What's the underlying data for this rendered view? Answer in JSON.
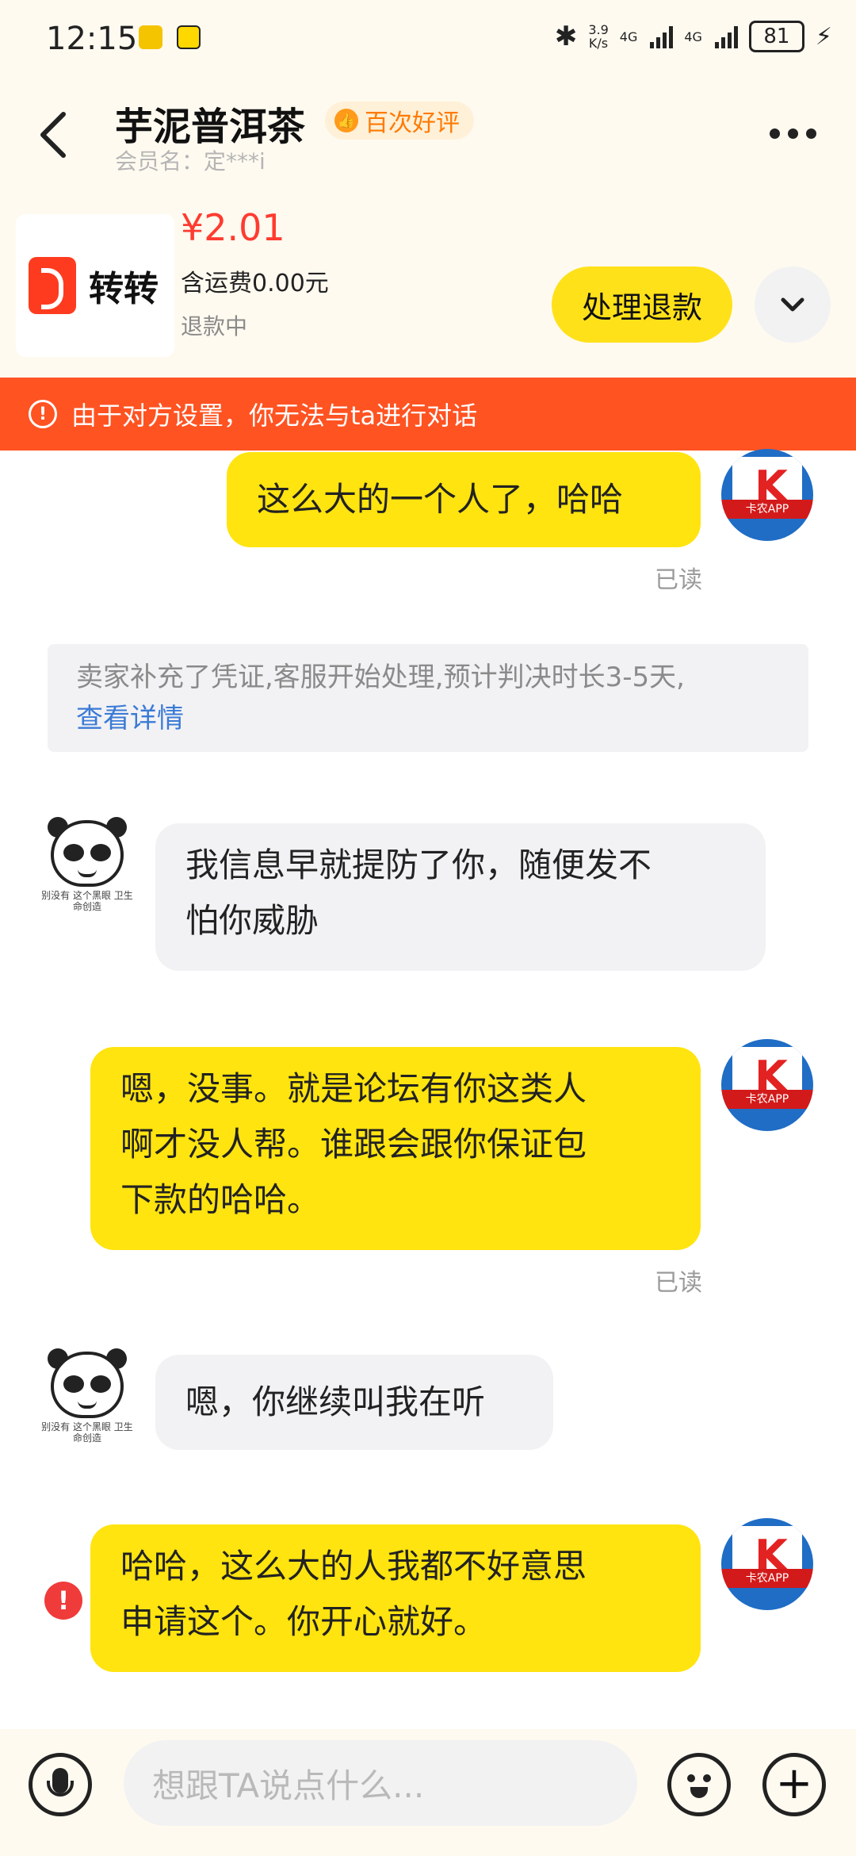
{
  "status_bar": {
    "time": "12:15",
    "net_speed_value": "3.9",
    "net_speed_unit": "K/s",
    "network_1": "4G",
    "network_2": "4G",
    "battery": "81"
  },
  "header": {
    "title": "芋泥普洱茶",
    "badge": "百次好评",
    "member": "会员名：定***i"
  },
  "product": {
    "logo_text": "转转",
    "price": "¥2.01",
    "shipping": "含运费0.00元",
    "status": "退款中",
    "action_button": "处理退款"
  },
  "banner": {
    "text": "由于对方设置，你无法与ta进行对话"
  },
  "messages": {
    "m1": "这么大的一个人了，哈哈",
    "read1": "已读",
    "system_note": "卖家补充了凭证,客服开始处理,预计判决时长3-5天,",
    "system_link": "查看详情",
    "m2_line1": "我信息早就提防了你，随便发不",
    "m2_line2": "怕你威胁",
    "m3_line1": "嗯，没事。就是论坛有你这类人",
    "m3_line2": "啊才没人帮。谁跟会跟你保证包",
    "m3_line3": "下款的哈哈。",
    "read2": "已读",
    "m4": "嗯，你继续叫我在听",
    "m5_line1": "哈哈，这么大的人我都不好意思",
    "m5_line2": "申请这个。你开心就好。"
  },
  "avatars": {
    "me_band": "卡农APP",
    "them_caption": "别没有 这个黑眼 卫生命创造"
  },
  "input": {
    "placeholder": "想跟TA说点什么..."
  }
}
